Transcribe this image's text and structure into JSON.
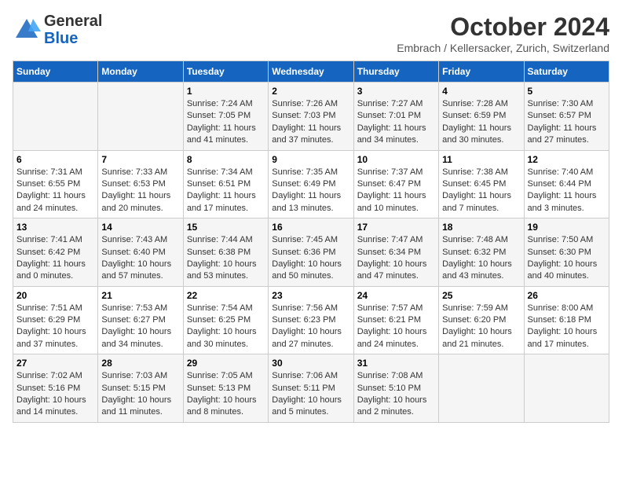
{
  "header": {
    "logo_general": "General",
    "logo_blue": "Blue",
    "month": "October 2024",
    "location": "Embrach / Kellersacker, Zurich, Switzerland"
  },
  "weekdays": [
    "Sunday",
    "Monday",
    "Tuesday",
    "Wednesday",
    "Thursday",
    "Friday",
    "Saturday"
  ],
  "weeks": [
    [
      {
        "day": "",
        "sunrise": "",
        "sunset": "",
        "daylight": ""
      },
      {
        "day": "",
        "sunrise": "",
        "sunset": "",
        "daylight": ""
      },
      {
        "day": "1",
        "sunrise": "Sunrise: 7:24 AM",
        "sunset": "Sunset: 7:05 PM",
        "daylight": "Daylight: 11 hours and 41 minutes."
      },
      {
        "day": "2",
        "sunrise": "Sunrise: 7:26 AM",
        "sunset": "Sunset: 7:03 PM",
        "daylight": "Daylight: 11 hours and 37 minutes."
      },
      {
        "day": "3",
        "sunrise": "Sunrise: 7:27 AM",
        "sunset": "Sunset: 7:01 PM",
        "daylight": "Daylight: 11 hours and 34 minutes."
      },
      {
        "day": "4",
        "sunrise": "Sunrise: 7:28 AM",
        "sunset": "Sunset: 6:59 PM",
        "daylight": "Daylight: 11 hours and 30 minutes."
      },
      {
        "day": "5",
        "sunrise": "Sunrise: 7:30 AM",
        "sunset": "Sunset: 6:57 PM",
        "daylight": "Daylight: 11 hours and 27 minutes."
      }
    ],
    [
      {
        "day": "6",
        "sunrise": "Sunrise: 7:31 AM",
        "sunset": "Sunset: 6:55 PM",
        "daylight": "Daylight: 11 hours and 24 minutes."
      },
      {
        "day": "7",
        "sunrise": "Sunrise: 7:33 AM",
        "sunset": "Sunset: 6:53 PM",
        "daylight": "Daylight: 11 hours and 20 minutes."
      },
      {
        "day": "8",
        "sunrise": "Sunrise: 7:34 AM",
        "sunset": "Sunset: 6:51 PM",
        "daylight": "Daylight: 11 hours and 17 minutes."
      },
      {
        "day": "9",
        "sunrise": "Sunrise: 7:35 AM",
        "sunset": "Sunset: 6:49 PM",
        "daylight": "Daylight: 11 hours and 13 minutes."
      },
      {
        "day": "10",
        "sunrise": "Sunrise: 7:37 AM",
        "sunset": "Sunset: 6:47 PM",
        "daylight": "Daylight: 11 hours and 10 minutes."
      },
      {
        "day": "11",
        "sunrise": "Sunrise: 7:38 AM",
        "sunset": "Sunset: 6:45 PM",
        "daylight": "Daylight: 11 hours and 7 minutes."
      },
      {
        "day": "12",
        "sunrise": "Sunrise: 7:40 AM",
        "sunset": "Sunset: 6:44 PM",
        "daylight": "Daylight: 11 hours and 3 minutes."
      }
    ],
    [
      {
        "day": "13",
        "sunrise": "Sunrise: 7:41 AM",
        "sunset": "Sunset: 6:42 PM",
        "daylight": "Daylight: 11 hours and 0 minutes."
      },
      {
        "day": "14",
        "sunrise": "Sunrise: 7:43 AM",
        "sunset": "Sunset: 6:40 PM",
        "daylight": "Daylight: 10 hours and 57 minutes."
      },
      {
        "day": "15",
        "sunrise": "Sunrise: 7:44 AM",
        "sunset": "Sunset: 6:38 PM",
        "daylight": "Daylight: 10 hours and 53 minutes."
      },
      {
        "day": "16",
        "sunrise": "Sunrise: 7:45 AM",
        "sunset": "Sunset: 6:36 PM",
        "daylight": "Daylight: 10 hours and 50 minutes."
      },
      {
        "day": "17",
        "sunrise": "Sunrise: 7:47 AM",
        "sunset": "Sunset: 6:34 PM",
        "daylight": "Daylight: 10 hours and 47 minutes."
      },
      {
        "day": "18",
        "sunrise": "Sunrise: 7:48 AM",
        "sunset": "Sunset: 6:32 PM",
        "daylight": "Daylight: 10 hours and 43 minutes."
      },
      {
        "day": "19",
        "sunrise": "Sunrise: 7:50 AM",
        "sunset": "Sunset: 6:30 PM",
        "daylight": "Daylight: 10 hours and 40 minutes."
      }
    ],
    [
      {
        "day": "20",
        "sunrise": "Sunrise: 7:51 AM",
        "sunset": "Sunset: 6:29 PM",
        "daylight": "Daylight: 10 hours and 37 minutes."
      },
      {
        "day": "21",
        "sunrise": "Sunrise: 7:53 AM",
        "sunset": "Sunset: 6:27 PM",
        "daylight": "Daylight: 10 hours and 34 minutes."
      },
      {
        "day": "22",
        "sunrise": "Sunrise: 7:54 AM",
        "sunset": "Sunset: 6:25 PM",
        "daylight": "Daylight: 10 hours and 30 minutes."
      },
      {
        "day": "23",
        "sunrise": "Sunrise: 7:56 AM",
        "sunset": "Sunset: 6:23 PM",
        "daylight": "Daylight: 10 hours and 27 minutes."
      },
      {
        "day": "24",
        "sunrise": "Sunrise: 7:57 AM",
        "sunset": "Sunset: 6:21 PM",
        "daylight": "Daylight: 10 hours and 24 minutes."
      },
      {
        "day": "25",
        "sunrise": "Sunrise: 7:59 AM",
        "sunset": "Sunset: 6:20 PM",
        "daylight": "Daylight: 10 hours and 21 minutes."
      },
      {
        "day": "26",
        "sunrise": "Sunrise: 8:00 AM",
        "sunset": "Sunset: 6:18 PM",
        "daylight": "Daylight: 10 hours and 17 minutes."
      }
    ],
    [
      {
        "day": "27",
        "sunrise": "Sunrise: 7:02 AM",
        "sunset": "Sunset: 5:16 PM",
        "daylight": "Daylight: 10 hours and 14 minutes."
      },
      {
        "day": "28",
        "sunrise": "Sunrise: 7:03 AM",
        "sunset": "Sunset: 5:15 PM",
        "daylight": "Daylight: 10 hours and 11 minutes."
      },
      {
        "day": "29",
        "sunrise": "Sunrise: 7:05 AM",
        "sunset": "Sunset: 5:13 PM",
        "daylight": "Daylight: 10 hours and 8 minutes."
      },
      {
        "day": "30",
        "sunrise": "Sunrise: 7:06 AM",
        "sunset": "Sunset: 5:11 PM",
        "daylight": "Daylight: 10 hours and 5 minutes."
      },
      {
        "day": "31",
        "sunrise": "Sunrise: 7:08 AM",
        "sunset": "Sunset: 5:10 PM",
        "daylight": "Daylight: 10 hours and 2 minutes."
      },
      {
        "day": "",
        "sunrise": "",
        "sunset": "",
        "daylight": ""
      },
      {
        "day": "",
        "sunrise": "",
        "sunset": "",
        "daylight": ""
      }
    ]
  ]
}
